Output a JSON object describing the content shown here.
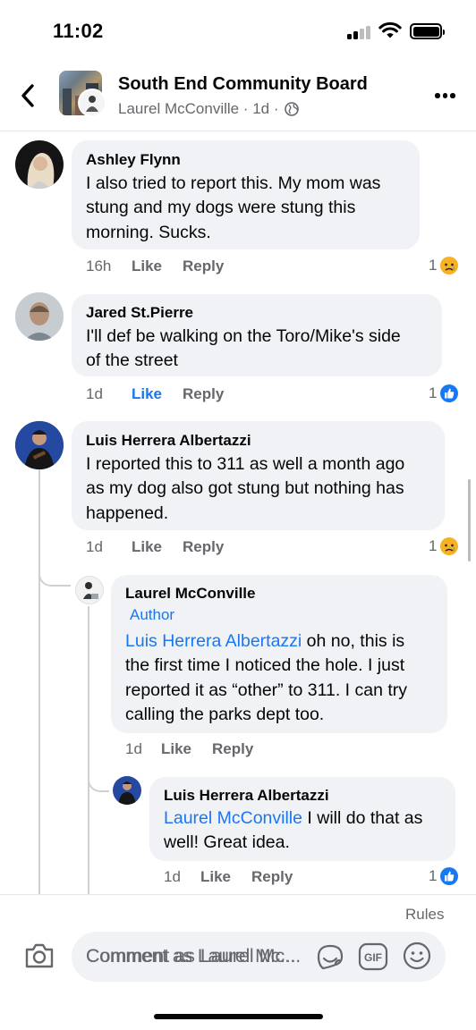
{
  "status_bar": {
    "time": "11:02"
  },
  "header": {
    "title": "South End Community Board",
    "subtitle": "Laurel McConville · 1d ·"
  },
  "comments": [
    {
      "author": "Ashley Flynn",
      "lines": [
        "I also tried to report this. My mom was",
        "stung and my dogs were stung this",
        "morning. Sucks."
      ],
      "time": "16h",
      "like": "Like",
      "reply": "Reply",
      "reaction_count": "1",
      "reaction": "sad"
    },
    {
      "author": "Jared St.Pierre",
      "lines": [
        "I'll def be walking on the Toro/Mike's side",
        "of the street"
      ],
      "time": "1d",
      "like": "Like",
      "reply": "Reply",
      "liked": true,
      "reaction_count": "1",
      "reaction": "like"
    },
    {
      "author": "Luis Herrera Albertazzi",
      "lines": [
        "I reported this to 311 as well a month ago",
        "as my dog also got stung but nothing has",
        "happened."
      ],
      "time": "1d",
      "like": "Like",
      "reply": "Reply",
      "reaction_count": "1",
      "reaction": "sad"
    },
    {
      "author": "Laurel McConville",
      "badge": "Author",
      "mention": "Luis Herrera Albertazzi",
      "lines": [
        " oh no, this is",
        "the first time I noticed the hole. I just",
        "reported it as “other” to 311. I can try",
        "calling the parks dept too."
      ],
      "time": "1d",
      "like": "Like",
      "reply": "Reply"
    },
    {
      "author": "Luis Herrera Albertazzi",
      "mention": "Laurel McConville",
      "lines": [
        " I will do that as",
        "well! Great idea."
      ],
      "time": "1d",
      "like": "Like",
      "reply": "Reply",
      "reaction_count": "1",
      "reaction": "like"
    }
  ],
  "composer": {
    "rules_label": "Rules",
    "placeholder": "Comment as Laurel Mc..."
  },
  "colors": {
    "link": "#1877f2",
    "bubble": "#f0f2f5",
    "meta": "#65676b"
  }
}
